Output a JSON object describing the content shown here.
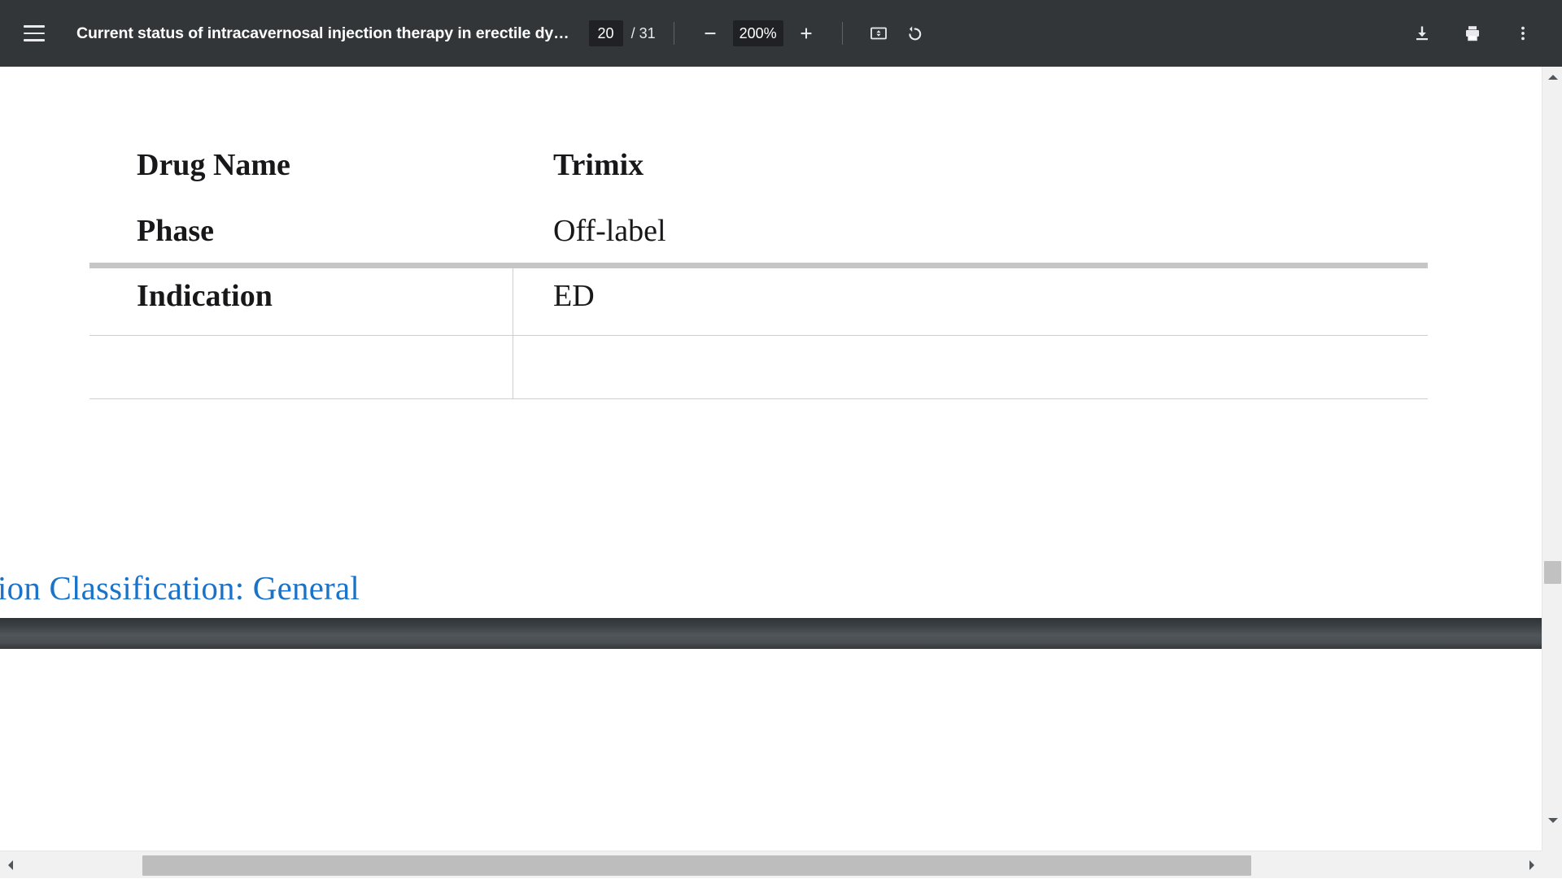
{
  "toolbar": {
    "menu_icon": "hamburger-menu-icon",
    "document_title": "Current status of intracavernosal injection therapy in erectile dy…",
    "current_page": "20",
    "page_total": "/ 31",
    "zoom_out_icon": "minus-icon",
    "zoom_level": "200%",
    "zoom_in_icon": "plus-icon",
    "fit_page_icon": "fit-to-page-icon",
    "rotate_icon": "rotate-counterclockwise-icon",
    "download_icon": "download-icon",
    "print_icon": "print-icon",
    "more_icon": "more-options-icon",
    "background_color": "#323639",
    "field_background": "#202124"
  },
  "document": {
    "table": {
      "header": {
        "label": "Drug Name",
        "value": "Trimix"
      },
      "rows": [
        {
          "label": "Phase",
          "value": "Off-label"
        },
        {
          "label": "Indication",
          "value": "ED"
        }
      ]
    },
    "classification_text": "Information Classification: General",
    "classification_color": "#1a73c8"
  },
  "scrollbars": {
    "vertical_up_icon": "scroll-up-arrow-icon",
    "vertical_down_icon": "scroll-down-arrow-icon",
    "horizontal_left_icon": "scroll-left-arrow-icon",
    "horizontal_right_icon": "scroll-right-arrow-icon"
  }
}
